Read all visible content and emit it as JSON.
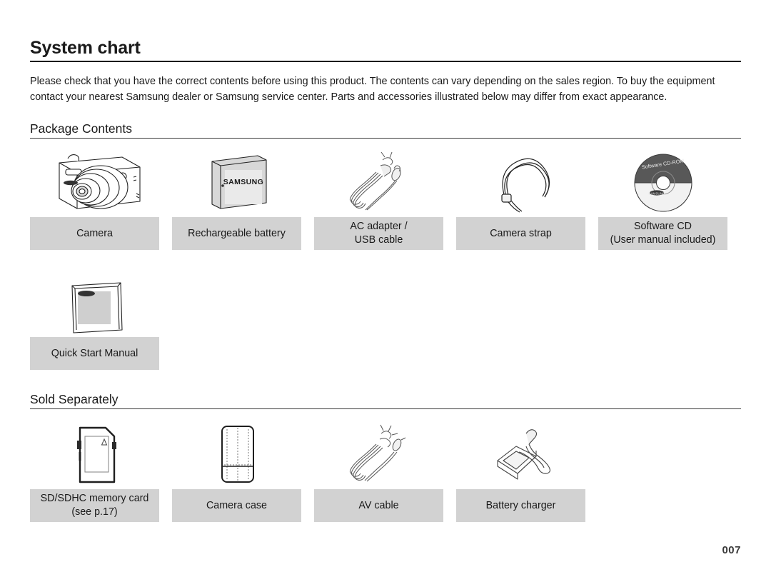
{
  "document": {
    "title": "System chart",
    "intro": "Please check that you have the correct contents before using this product. The contents can vary depending on the sales region. To buy the equipment contact your nearest Samsung dealer or Samsung service center. Parts and accessories illustrated below may differ from exact appearance.",
    "page_number": "007"
  },
  "sections": {
    "package_contents": {
      "title": "Package Contents",
      "items": [
        {
          "icon": "camera-icon",
          "label_line1": "Camera",
          "label_line2": ""
        },
        {
          "icon": "battery-icon",
          "label_line1": "Rechargeable battery",
          "label_line2": ""
        },
        {
          "icon": "ac-adapter-usb-cable-icon",
          "label_line1": "AC adapter /",
          "label_line2": "USB cable"
        },
        {
          "icon": "camera-strap-icon",
          "label_line1": "Camera strap",
          "label_line2": ""
        },
        {
          "icon": "software-cd-icon",
          "label_line1": "Software CD",
          "label_line2": "(User manual included)"
        },
        {
          "icon": "quick-start-manual-icon",
          "label_line1": "Quick Start Manual",
          "label_line2": ""
        }
      ]
    },
    "sold_separately": {
      "title": "Sold Separately",
      "items": [
        {
          "icon": "sd-card-icon",
          "label_line1": "SD/SDHC memory card",
          "label_line2": "(see p.17)"
        },
        {
          "icon": "camera-case-icon",
          "label_line1": "Camera case",
          "label_line2": ""
        },
        {
          "icon": "av-cable-icon",
          "label_line1": "AV cable",
          "label_line2": ""
        },
        {
          "icon": "battery-charger-icon",
          "label_line1": "Battery charger",
          "label_line2": ""
        }
      ]
    }
  },
  "artwork_text": {
    "battery_brand": "SAMSUNG",
    "cd_label": "Software CD-ROM"
  },
  "colors": {
    "label_background": "#d2d2d2",
    "text": "#1a1a1a",
    "cd_body": "#585858",
    "page_number": "#3a3a3a"
  }
}
